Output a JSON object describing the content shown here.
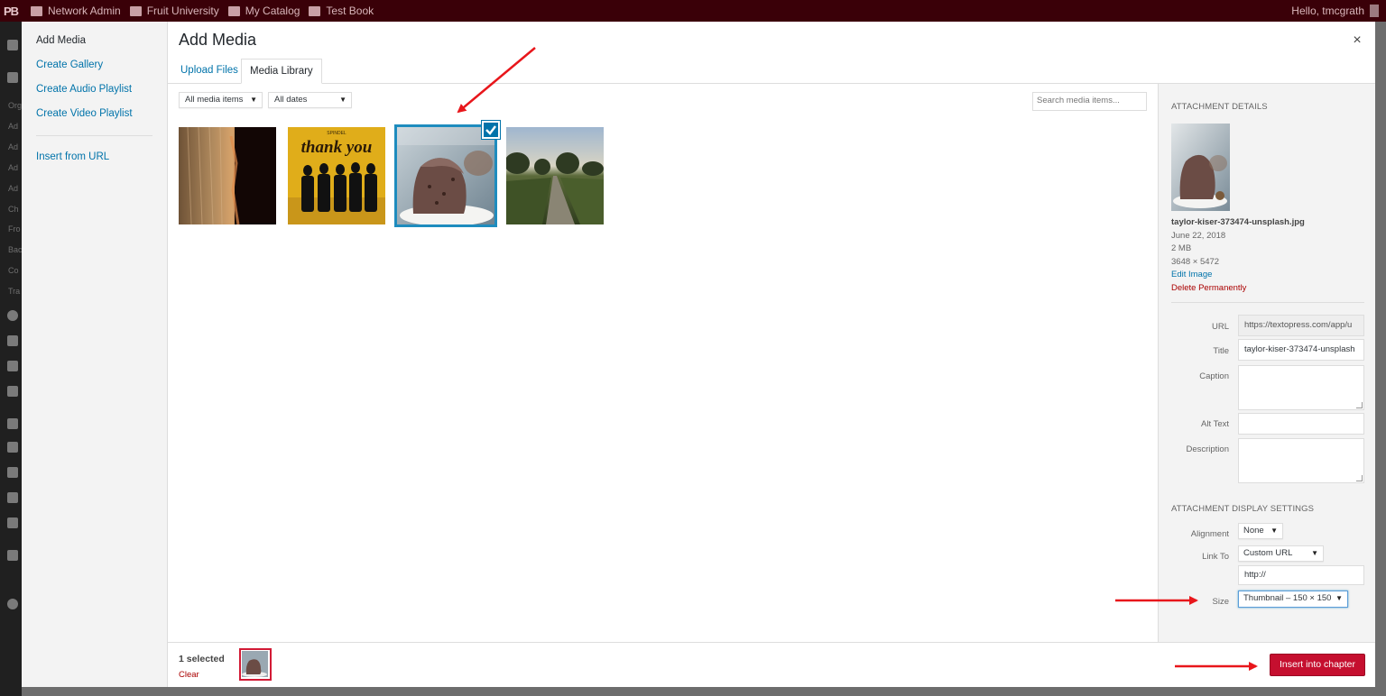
{
  "adminbar": {
    "logo": "PB",
    "items": [
      {
        "label": "Network Admin",
        "icon": "network-icon"
      },
      {
        "label": "Fruit University",
        "icon": "home-icon"
      },
      {
        "label": "My Catalog",
        "icon": "folder-icon"
      },
      {
        "label": "Test Book",
        "icon": "book-icon"
      }
    ],
    "greeting": "Hello, tmcgrath"
  },
  "admin_side_fragments": [
    "Org",
    "Ad",
    "Ad",
    "Ad",
    "Ad",
    "Ch",
    "Fro",
    "Bac",
    "Co",
    "Tra"
  ],
  "media_menu": {
    "items": [
      {
        "label": "Add Media",
        "active": true
      },
      {
        "label": "Create Gallery"
      },
      {
        "label": "Create Audio Playlist"
      },
      {
        "label": "Create Video Playlist"
      }
    ],
    "insert_from_url": "Insert from URL"
  },
  "frame": {
    "title": "Add Media",
    "close": "×",
    "tabs": [
      {
        "label": "Upload Files"
      },
      {
        "label": "Media Library",
        "active": true
      }
    ]
  },
  "toolbar": {
    "filter_type": "All media items",
    "filter_date": "All dates",
    "search_placeholder": "Search media items..."
  },
  "media_items": [
    {
      "name": "wheat-sunset",
      "selected": false
    },
    {
      "name": "thank-you-spindel",
      "selected": false,
      "overlay_text": "thank you",
      "overlay_small": "SPINDEL"
    },
    {
      "name": "taylor-kiser-373474-unsplash",
      "selected": true
    },
    {
      "name": "country-road",
      "selected": false
    }
  ],
  "details": {
    "heading": "Attachment Details",
    "filename": "taylor-kiser-373474-unsplash.jpg",
    "date": "June 22, 2018",
    "size": "2 MB",
    "dimensions": "3648 × 5472",
    "edit_link": "Edit Image",
    "delete_link": "Delete Permanently",
    "fields": {
      "url_label": "URL",
      "url_value": "https://textopress.com/app/u",
      "title_label": "Title",
      "title_value": "taylor-kiser-373474-unsplash",
      "caption_label": "Caption",
      "alt_label": "Alt Text",
      "description_label": "Description"
    }
  },
  "display_settings": {
    "heading": "Attachment Display Settings",
    "alignment_label": "Alignment",
    "alignment_value": "None",
    "link_label": "Link To",
    "link_value": "Custom URL",
    "link_url": "http://",
    "size_label": "Size",
    "size_value": "Thumbnail – 150 × 150"
  },
  "footer": {
    "selected_count": "1 selected",
    "clear": "Clear",
    "insert_button": "Insert into chapter"
  },
  "colors": {
    "adminbar": "#3a0008",
    "link": "#0073aa",
    "primary_button": "#c50f2f",
    "selection": "#1e8cbe",
    "annotation": "#e8161b"
  }
}
